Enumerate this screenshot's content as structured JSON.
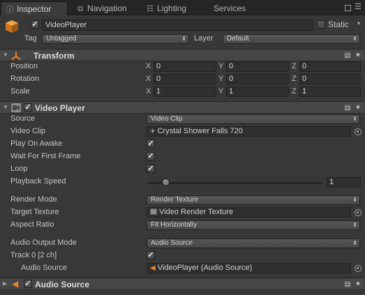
{
  "tabs": [
    {
      "label": "Inspector",
      "icon": "info-icon",
      "glyph": "ⓘ"
    },
    {
      "label": "Navigation",
      "icon": "navigation-icon",
      "glyph": "⧉"
    },
    {
      "label": "Lighting",
      "icon": "lighting-icon",
      "glyph": "☷"
    },
    {
      "label": "Services",
      "icon": "services-icon",
      "glyph": "☁"
    }
  ],
  "object": {
    "name": "VideoPlayer",
    "active": true,
    "static_label": "Static",
    "static_checked": false,
    "tag_label": "Tag",
    "tag_value": "Untagged",
    "layer_label": "Layer",
    "layer_value": "Default"
  },
  "transform": {
    "title": "Transform",
    "rows": [
      {
        "label": "Position",
        "x": "0",
        "y": "0",
        "z": "0"
      },
      {
        "label": "Rotation",
        "x": "0",
        "y": "0",
        "z": "0"
      },
      {
        "label": "Scale",
        "x": "1",
        "y": "1",
        "z": "1"
      }
    ],
    "axis_x": "X",
    "axis_y": "Y",
    "axis_z": "Z"
  },
  "video_player": {
    "title": "Video Player",
    "enabled": true,
    "source_label": "Source",
    "source_value": "Video Clip",
    "clip_label": "Video Clip",
    "clip_value": "Crystal Shower Falls 720",
    "play_on_awake_label": "Play On Awake",
    "play_on_awake": true,
    "wait_label": "Wait For First Frame",
    "wait": true,
    "loop_label": "Loop",
    "loop": true,
    "speed_label": "Playback Speed",
    "speed_value": "1",
    "speed_fraction": 0.1,
    "render_mode_label": "Render Mode",
    "render_mode_value": "Render Texture",
    "target_texture_label": "Target Texture",
    "target_texture_value": "Video Render Texture",
    "aspect_label": "Aspect Ratio",
    "aspect_value": "Fit Horizontally",
    "audio_mode_label": "Audio Output Mode",
    "audio_mode_value": "Audio Source",
    "track_label": "Track 0 [2 ch]",
    "track_enabled": true,
    "audio_source_label": "Audio Source",
    "audio_source_value": "VideoPlayer (Audio Source)"
  },
  "audio_source": {
    "title": "Audio Source",
    "enabled": true
  },
  "colors": {
    "accent_orange": "#e8832a",
    "panel_bg": "#383838"
  }
}
